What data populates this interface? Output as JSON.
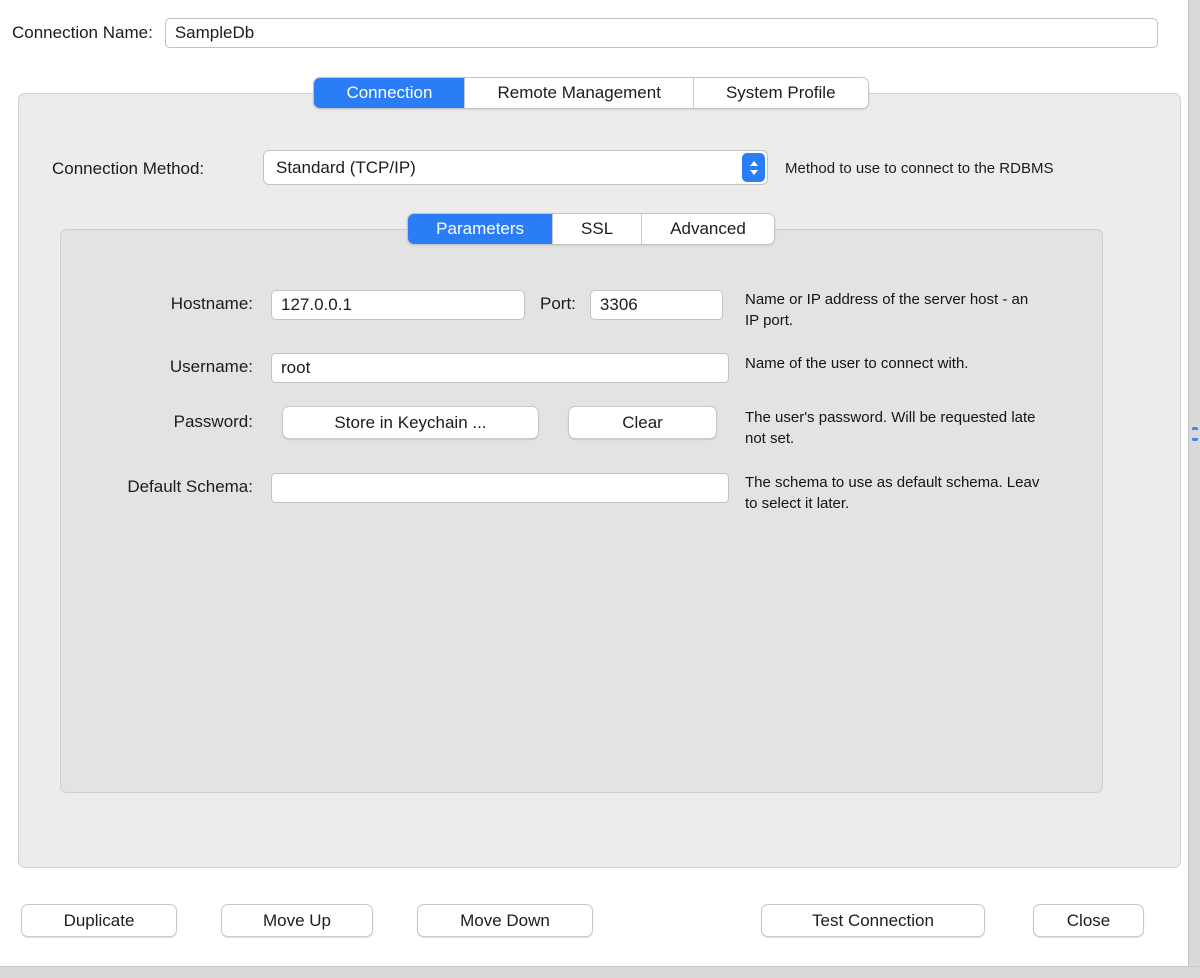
{
  "colors": {
    "accent": "#2a7cf7"
  },
  "header": {
    "connection_name_label": "Connection Name:",
    "connection_name_value": "SampleDb"
  },
  "tabs": [
    {
      "label": "Connection"
    },
    {
      "label": "Remote Management"
    },
    {
      "label": "System Profile"
    }
  ],
  "method": {
    "label": "Connection Method:",
    "value": "Standard (TCP/IP)",
    "help": "Method to use to connect to the RDBMS"
  },
  "sub_tabs": [
    {
      "label": "Parameters"
    },
    {
      "label": "SSL"
    },
    {
      "label": "Advanced"
    }
  ],
  "form": {
    "hostname_label": "Hostname:",
    "hostname_value": "127.0.0.1",
    "port_label": "Port:",
    "port_value": "3306",
    "hostname_help_line1": "Name or IP address of the server host - an",
    "hostname_help_line2": "IP port.",
    "username_label": "Username:",
    "username_value": "root",
    "username_help_line1": "Name of the user to connect with.",
    "password_label": "Password:",
    "store_keychain_button": "Store in Keychain ...",
    "clear_button": "Clear",
    "password_help_line1": "The user's password. Will be requested late",
    "password_help_line2": "not set.",
    "schema_label": "Default Schema:",
    "schema_value": "",
    "schema_help_line1": "The schema to use as default schema. Leav",
    "schema_help_line2": "to select it later."
  },
  "actions": {
    "duplicate": "Duplicate",
    "move_up": "Move Up",
    "move_down": "Move Down",
    "test_connection": "Test Connection",
    "close": "Close"
  }
}
